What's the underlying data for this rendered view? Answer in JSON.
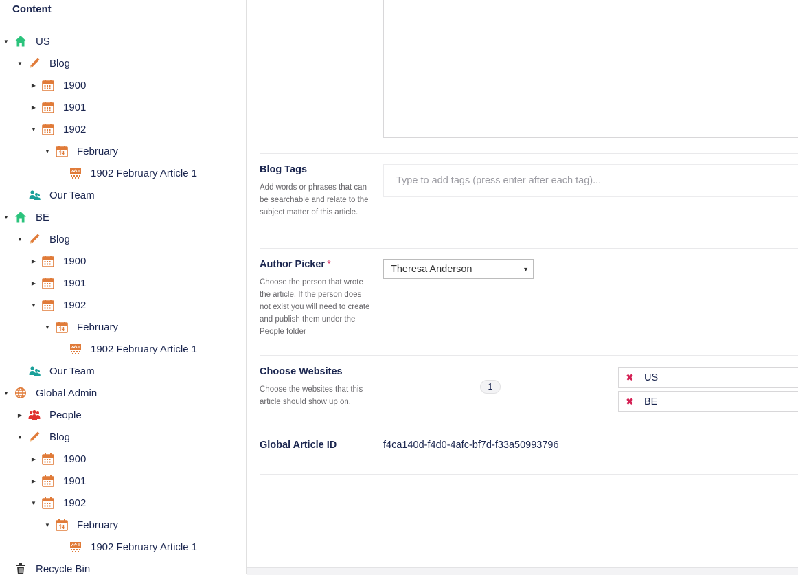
{
  "sidebar": {
    "title": "Content",
    "nodes": [
      {
        "label": "US",
        "icon": "home-icon",
        "level": 0,
        "toggle": "expanded"
      },
      {
        "label": "Blog",
        "icon": "pencil-icon",
        "level": 1,
        "toggle": "expanded"
      },
      {
        "label": "1900",
        "icon": "calendar-icon",
        "level": 2,
        "toggle": "collapsed"
      },
      {
        "label": "1901",
        "icon": "calendar-icon",
        "level": 2,
        "toggle": "collapsed"
      },
      {
        "label": "1902",
        "icon": "calendar-icon",
        "level": 2,
        "toggle": "expanded"
      },
      {
        "label": "February",
        "icon": "calendar-day-icon",
        "level": 3,
        "toggle": "expanded"
      },
      {
        "label": "1902 February Article 1",
        "icon": "article-icon",
        "level": 4,
        "toggle": "none"
      },
      {
        "label": "Our Team",
        "icon": "team-icon",
        "level": 1,
        "toggle": "none"
      },
      {
        "label": "BE",
        "icon": "home-icon",
        "level": 0,
        "toggle": "expanded"
      },
      {
        "label": "Blog",
        "icon": "pencil-icon",
        "level": 1,
        "toggle": "expanded"
      },
      {
        "label": "1900",
        "icon": "calendar-icon",
        "level": 2,
        "toggle": "collapsed"
      },
      {
        "label": "1901",
        "icon": "calendar-icon",
        "level": 2,
        "toggle": "collapsed"
      },
      {
        "label": "1902",
        "icon": "calendar-icon",
        "level": 2,
        "toggle": "expanded"
      },
      {
        "label": "February",
        "icon": "calendar-day-icon",
        "level": 3,
        "toggle": "expanded"
      },
      {
        "label": "1902 February Article 1",
        "icon": "article-icon",
        "level": 4,
        "toggle": "none"
      },
      {
        "label": "Our Team",
        "icon": "team-icon",
        "level": 1,
        "toggle": "none"
      },
      {
        "label": "Global Admin",
        "icon": "globe-icon",
        "level": 0,
        "toggle": "expanded"
      },
      {
        "label": "People",
        "icon": "people-icon",
        "level": 1,
        "toggle": "collapsed"
      },
      {
        "label": "Blog",
        "icon": "pencil-icon",
        "level": 1,
        "toggle": "expanded"
      },
      {
        "label": "1900",
        "icon": "calendar-icon",
        "level": 2,
        "toggle": "collapsed"
      },
      {
        "label": "1901",
        "icon": "calendar-icon",
        "level": 2,
        "toggle": "collapsed"
      },
      {
        "label": "1902",
        "icon": "calendar-icon",
        "level": 2,
        "toggle": "expanded"
      },
      {
        "label": "February",
        "icon": "calendar-day-icon",
        "level": 3,
        "toggle": "expanded"
      },
      {
        "label": "1902 February Article 1",
        "icon": "article-icon",
        "level": 4,
        "toggle": "none"
      },
      {
        "label": "Recycle Bin",
        "icon": "trash-icon",
        "level": 0,
        "toggle": "none"
      }
    ]
  },
  "colors": {
    "home": "#2bc37c",
    "pencil": "#e07b39",
    "calendar": "#e07b39",
    "team": "#1aa09a",
    "people": "#e0302f",
    "globe": "#e07b39",
    "required": "#d42054",
    "remove": "#d42054"
  },
  "form": {
    "blog_tags": {
      "label": "Blog Tags",
      "description": "Add words or phrases that can be searchable and relate to the subject matter of this article.",
      "placeholder": "Type to add tags (press enter after each tag)..."
    },
    "author_picker": {
      "label": "Author Picker",
      "required_mark": "*",
      "description": "Choose the person that wrote the article. If the person does not exist you will need to create and publish them under the People folder",
      "selected": "Theresa Anderson"
    },
    "choose_websites": {
      "label": "Choose Websites",
      "description": "Choose the websites that this article should show up on.",
      "count": "1",
      "sites": [
        {
          "remove": "✖",
          "label": "US"
        },
        {
          "remove": "✖",
          "label": "BE"
        }
      ]
    },
    "global_article_id": {
      "label": "Global Article ID",
      "value": "f4ca140d-f4d0-4afc-bf7d-f33a50993796"
    }
  }
}
